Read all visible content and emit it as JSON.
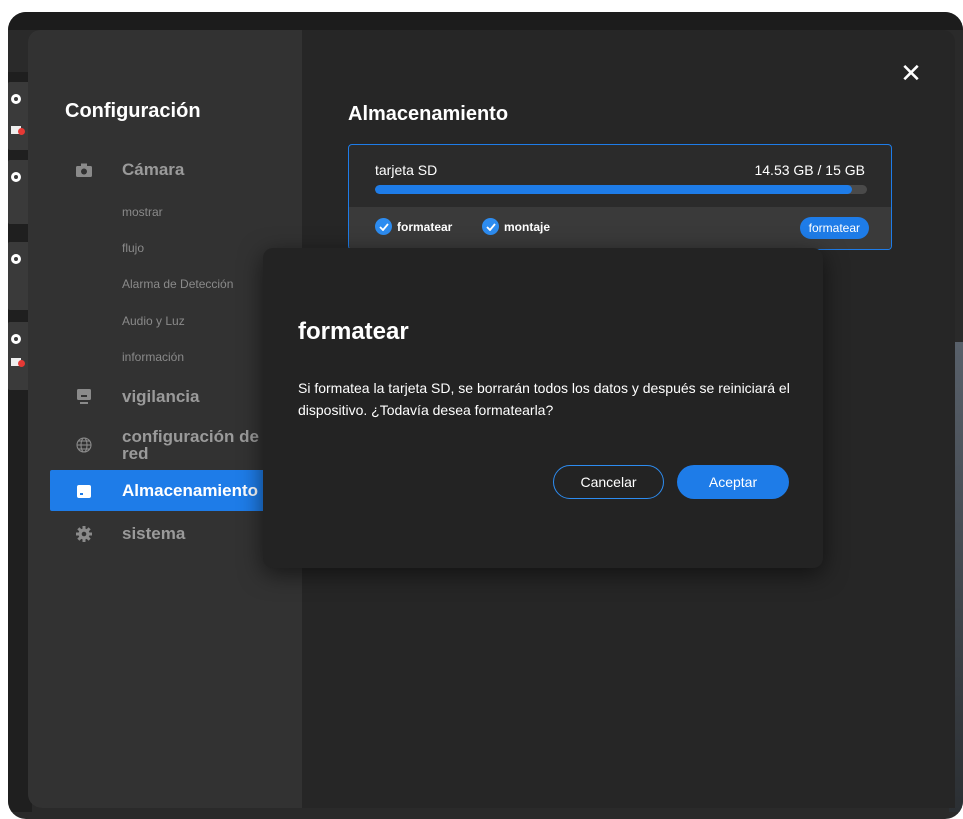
{
  "sidebar": {
    "title": "Configuración",
    "items": [
      {
        "label": "Cámara",
        "icon": "camera-icon"
      },
      {
        "label": "vigilancia",
        "icon": "monitor-icon"
      },
      {
        "label": "configuración de red",
        "icon": "globe-icon"
      },
      {
        "label": "Almacenamiento",
        "icon": "storage-icon",
        "active": true
      },
      {
        "label": "sistema",
        "icon": "gear-icon"
      }
    ],
    "camera_subitems": [
      "mostrar",
      "flujo",
      "Alarma de Detección",
      "Audio y Luz",
      "información"
    ]
  },
  "main": {
    "title": "Almacenamiento",
    "close_icon": "close-icon",
    "sd_card": {
      "label": "tarjeta SD",
      "capacity": "14.53 GB / 15 GB",
      "usage_fraction": 0.969,
      "status_items": [
        "formatear",
        "montaje"
      ],
      "format_button": "formatear"
    }
  },
  "dialog": {
    "title": "formatear",
    "message": "Si formatea la tarjeta SD, se borrarán todos los datos y después se reiniciará el dispositivo. ¿Todavía desea formatearla?",
    "cancel_label": "Cancelar",
    "accept_label": "Aceptar"
  },
  "colors": {
    "accent": "#1e7ce8",
    "sidebar_bg": "#323232",
    "panel_bg": "#262626",
    "dialog_bg": "#232323"
  }
}
